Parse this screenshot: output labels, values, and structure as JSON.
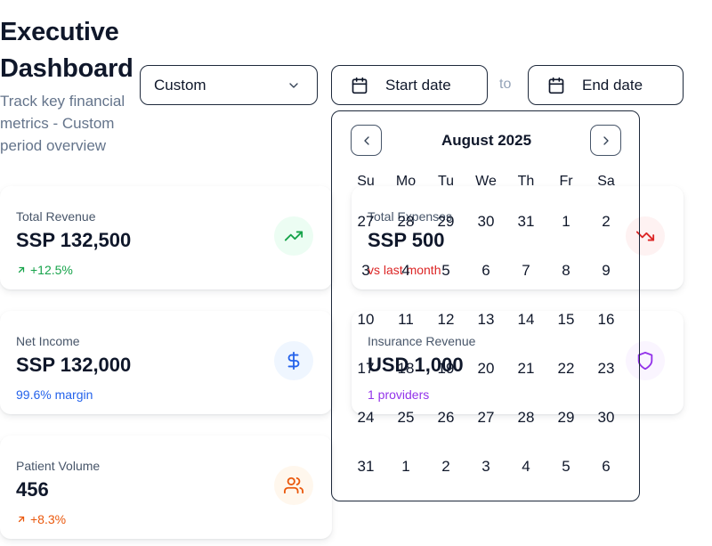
{
  "header": {
    "title": "Executive Dashboard",
    "subtitle": "Track key financial metrics - Custom period overview"
  },
  "filters": {
    "period_value": "Custom",
    "start_placeholder": "Start date",
    "to_label": "to",
    "end_placeholder": "End date"
  },
  "cards": [
    {
      "label": "Total Revenue",
      "value": "SSP 132,500",
      "sub": "+12.5%",
      "icon": "trending-up-icon",
      "color": "#16a34a"
    },
    {
      "label": "Total Expenses",
      "value": "SSP 500",
      "sub": "vs last month",
      "icon": "trending-down-icon",
      "color": "#dc2626"
    },
    {
      "label": "Net Income",
      "value": "SSP 132,000",
      "sub": "99.6% margin",
      "icon": "dollar-icon",
      "color": "#2563eb"
    },
    {
      "label": "Insurance Revenue",
      "value": "USD 1,000",
      "sub": "1 providers",
      "icon": "shield-icon",
      "color": "#9333ea"
    },
    {
      "label": "Patient Volume",
      "value": "456",
      "sub": "+8.3%",
      "icon": "users-icon",
      "color": "#ea580c"
    }
  ],
  "calendar": {
    "month_label": "August 2025",
    "weekdays": [
      "Su",
      "Mo",
      "Tu",
      "We",
      "Th",
      "Fr",
      "Sa"
    ],
    "weeks": [
      [
        "27",
        "28",
        "29",
        "30",
        "31",
        "1",
        "2"
      ],
      [
        "3",
        "4",
        "5",
        "6",
        "7",
        "8",
        "9"
      ],
      [
        "10",
        "11",
        "12",
        "13",
        "14",
        "15",
        "16"
      ],
      [
        "17",
        "18",
        "19",
        "20",
        "21",
        "22",
        "23"
      ],
      [
        "24",
        "25",
        "26",
        "27",
        "28",
        "29",
        "30"
      ],
      [
        "31",
        "1",
        "2",
        "3",
        "4",
        "5",
        "6"
      ]
    ]
  }
}
